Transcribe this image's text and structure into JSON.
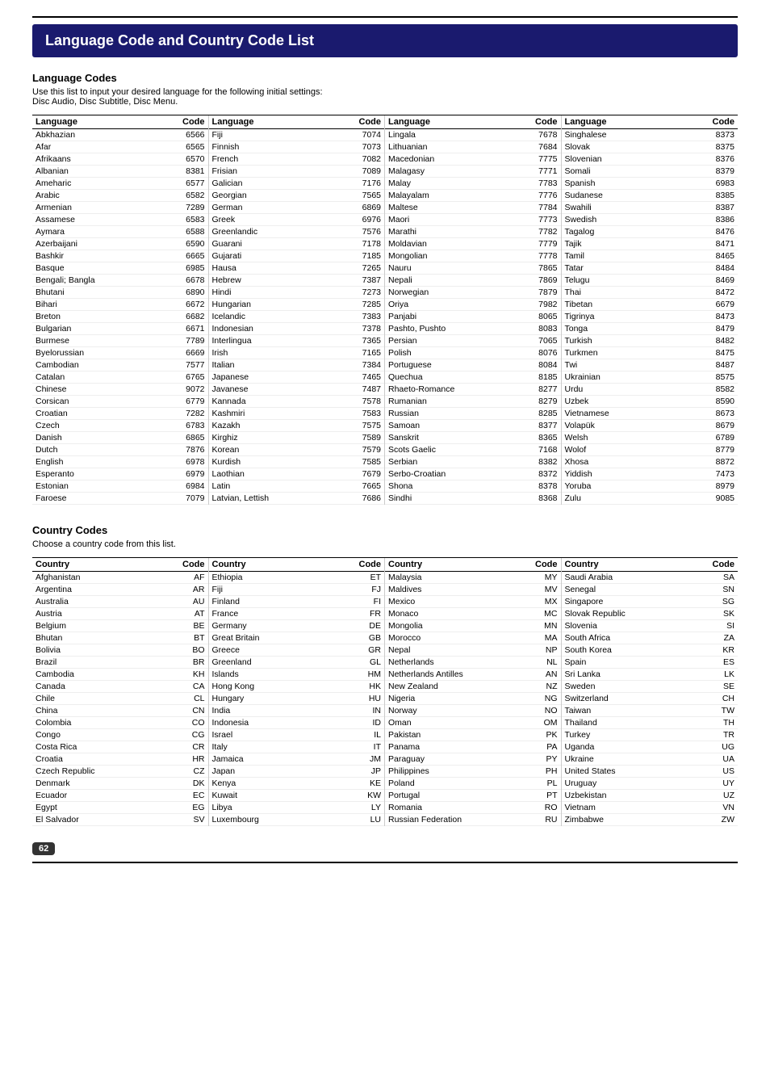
{
  "page": {
    "title": "Language Code and Country Code List",
    "language_section": {
      "heading": "Language Codes",
      "desc1": "Use this list to input your desired language for the following initial settings:",
      "desc2": "Disc Audio, Disc Subtitle, Disc Menu."
    },
    "country_section": {
      "heading": "Country Codes",
      "desc1": "Choose a country code from this list."
    },
    "page_number": "62"
  },
  "language_columns": [
    {
      "header_lang": "Language",
      "header_code": "Code",
      "rows": [
        [
          "Abkhazian",
          "6566"
        ],
        [
          "Afar",
          "6565"
        ],
        [
          "Afrikaans",
          "6570"
        ],
        [
          "Albanian",
          "8381"
        ],
        [
          "Ameharic",
          "6577"
        ],
        [
          "Arabic",
          "6582"
        ],
        [
          "Armenian",
          "7289"
        ],
        [
          "Assamese",
          "6583"
        ],
        [
          "Aymara",
          "6588"
        ],
        [
          "Azerbaijani",
          "6590"
        ],
        [
          "Bashkir",
          "6665"
        ],
        [
          "Basque",
          "6985"
        ],
        [
          "Bengali; Bangla",
          "6678"
        ],
        [
          "Bhutani",
          "6890"
        ],
        [
          "Bihari",
          "6672"
        ],
        [
          "Breton",
          "6682"
        ],
        [
          "Bulgarian",
          "6671"
        ],
        [
          "Burmese",
          "7789"
        ],
        [
          "Byelorussian",
          "6669"
        ],
        [
          "Cambodian",
          "7577"
        ],
        [
          "Catalan",
          "6765"
        ],
        [
          "Chinese",
          "9072"
        ],
        [
          "Corsican",
          "6779"
        ],
        [
          "Croatian",
          "7282"
        ],
        [
          "Czech",
          "6783"
        ],
        [
          "Danish",
          "6865"
        ],
        [
          "Dutch",
          "7876"
        ],
        [
          "English",
          "6978"
        ],
        [
          "Esperanto",
          "6979"
        ],
        [
          "Estonian",
          "6984"
        ],
        [
          "Faroese",
          "7079"
        ]
      ]
    },
    {
      "header_lang": "Language",
      "header_code": "Code",
      "rows": [
        [
          "Fiji",
          "7074"
        ],
        [
          "Finnish",
          "7073"
        ],
        [
          "French",
          "7082"
        ],
        [
          "Frisian",
          "7089"
        ],
        [
          "Galician",
          "7176"
        ],
        [
          "Georgian",
          "7565"
        ],
        [
          "German",
          "6869"
        ],
        [
          "Greek",
          "6976"
        ],
        [
          "Greenlandic",
          "7576"
        ],
        [
          "Guarani",
          "7178"
        ],
        [
          "Gujarati",
          "7185"
        ],
        [
          "Hausa",
          "7265"
        ],
        [
          "Hebrew",
          "7387"
        ],
        [
          "Hindi",
          "7273"
        ],
        [
          "Hungarian",
          "7285"
        ],
        [
          "Icelandic",
          "7383"
        ],
        [
          "Indonesian",
          "7378"
        ],
        [
          "Interlingua",
          "7365"
        ],
        [
          "Irish",
          "7165"
        ],
        [
          "Italian",
          "7384"
        ],
        [
          "Japanese",
          "7465"
        ],
        [
          "Javanese",
          "7487"
        ],
        [
          "Kannada",
          "7578"
        ],
        [
          "Kashmiri",
          "7583"
        ],
        [
          "Kazakh",
          "7575"
        ],
        [
          "Kirghiz",
          "7589"
        ],
        [
          "Korean",
          "7579"
        ],
        [
          "Kurdish",
          "7585"
        ],
        [
          "Laothian",
          "7679"
        ],
        [
          "Latin",
          "7665"
        ],
        [
          "Latvian, Lettish",
          "7686"
        ]
      ]
    },
    {
      "header_lang": "Language",
      "header_code": "Code",
      "rows": [
        [
          "Lingala",
          "7678"
        ],
        [
          "Lithuanian",
          "7684"
        ],
        [
          "Macedonian",
          "7775"
        ],
        [
          "Malagasy",
          "7771"
        ],
        [
          "Malay",
          "7783"
        ],
        [
          "Malayalam",
          "7776"
        ],
        [
          "Maltese",
          "7784"
        ],
        [
          "Maori",
          "7773"
        ],
        [
          "Marathi",
          "7782"
        ],
        [
          "Moldavian",
          "7779"
        ],
        [
          "Mongolian",
          "7778"
        ],
        [
          "Nauru",
          "7865"
        ],
        [
          "Nepali",
          "7869"
        ],
        [
          "Norwegian",
          "7879"
        ],
        [
          "Oriya",
          "7982"
        ],
        [
          "Panjabi",
          "8065"
        ],
        [
          "Pashto, Pushto",
          "8083"
        ],
        [
          "Persian",
          "7065"
        ],
        [
          "Polish",
          "8076"
        ],
        [
          "Portuguese",
          "8084"
        ],
        [
          "Quechua",
          "8185"
        ],
        [
          "Rhaeto-Romance",
          "8277"
        ],
        [
          "Rumanian",
          "8279"
        ],
        [
          "Russian",
          "8285"
        ],
        [
          "Samoan",
          "8377"
        ],
        [
          "Sanskrit",
          "8365"
        ],
        [
          "Scots Gaelic",
          "7168"
        ],
        [
          "Serbian",
          "8382"
        ],
        [
          "Serbo-Croatian",
          "8372"
        ],
        [
          "Shona",
          "8378"
        ],
        [
          "Sindhi",
          "8368"
        ]
      ]
    },
    {
      "header_lang": "Language",
      "header_code": "Code",
      "rows": [
        [
          "Singhalese",
          "8373"
        ],
        [
          "Slovak",
          "8375"
        ],
        [
          "Slovenian",
          "8376"
        ],
        [
          "Somali",
          "8379"
        ],
        [
          "Spanish",
          "6983"
        ],
        [
          "Sudanese",
          "8385"
        ],
        [
          "Swahili",
          "8387"
        ],
        [
          "Swedish",
          "8386"
        ],
        [
          "Tagalog",
          "8476"
        ],
        [
          "Tajik",
          "8471"
        ],
        [
          "Tamil",
          "8465"
        ],
        [
          "Tatar",
          "8484"
        ],
        [
          "Telugu",
          "8469"
        ],
        [
          "Thai",
          "8472"
        ],
        [
          "Tibetan",
          "6679"
        ],
        [
          "Tigrinya",
          "8473"
        ],
        [
          "Tonga",
          "8479"
        ],
        [
          "Turkish",
          "8482"
        ],
        [
          "Turkmen",
          "8475"
        ],
        [
          "Twi",
          "8487"
        ],
        [
          "Ukrainian",
          "8575"
        ],
        [
          "Urdu",
          "8582"
        ],
        [
          "Uzbek",
          "8590"
        ],
        [
          "Vietnamese",
          "8673"
        ],
        [
          "Volapük",
          "8679"
        ],
        [
          "Welsh",
          "6789"
        ],
        [
          "Wolof",
          "8779"
        ],
        [
          "Xhosa",
          "8872"
        ],
        [
          "Yiddish",
          "7473"
        ],
        [
          "Yoruba",
          "8979"
        ],
        [
          "Zulu",
          "9085"
        ]
      ]
    }
  ],
  "country_columns": [
    {
      "header_country": "Country",
      "header_code": "Code",
      "rows": [
        [
          "Afghanistan",
          "AF"
        ],
        [
          "Argentina",
          "AR"
        ],
        [
          "Australia",
          "AU"
        ],
        [
          "Austria",
          "AT"
        ],
        [
          "Belgium",
          "BE"
        ],
        [
          "Bhutan",
          "BT"
        ],
        [
          "Bolivia",
          "BO"
        ],
        [
          "Brazil",
          "BR"
        ],
        [
          "Cambodia",
          "KH"
        ],
        [
          "Canada",
          "CA"
        ],
        [
          "Chile",
          "CL"
        ],
        [
          "China",
          "CN"
        ],
        [
          "Colombia",
          "CO"
        ],
        [
          "Congo",
          "CG"
        ],
        [
          "Costa Rica",
          "CR"
        ],
        [
          "Croatia",
          "HR"
        ],
        [
          "Czech Republic",
          "CZ"
        ],
        [
          "Denmark",
          "DK"
        ],
        [
          "Ecuador",
          "EC"
        ],
        [
          "Egypt",
          "EG"
        ],
        [
          "El Salvador",
          "SV"
        ]
      ]
    },
    {
      "header_country": "Country",
      "header_code": "Code",
      "rows": [
        [
          "Ethiopia",
          "ET"
        ],
        [
          "Fiji",
          "FJ"
        ],
        [
          "Finland",
          "FI"
        ],
        [
          "France",
          "FR"
        ],
        [
          "Germany",
          "DE"
        ],
        [
          "Great Britain",
          "GB"
        ],
        [
          "Greece",
          "GR"
        ],
        [
          "Greenland",
          "GL"
        ],
        [
          "Islands",
          "HM"
        ],
        [
          "Hong Kong",
          "HK"
        ],
        [
          "Hungary",
          "HU"
        ],
        [
          "India",
          "IN"
        ],
        [
          "Indonesia",
          "ID"
        ],
        [
          "Israel",
          "IL"
        ],
        [
          "Italy",
          "IT"
        ],
        [
          "Jamaica",
          "JM"
        ],
        [
          "Japan",
          "JP"
        ],
        [
          "Kenya",
          "KE"
        ],
        [
          "Kuwait",
          "KW"
        ],
        [
          "Libya",
          "LY"
        ],
        [
          "Luxembourg",
          "LU"
        ]
      ]
    },
    {
      "header_country": "Country",
      "header_code": "Code",
      "rows": [
        [
          "Malaysia",
          "MY"
        ],
        [
          "Maldives",
          "MV"
        ],
        [
          "Mexico",
          "MX"
        ],
        [
          "Monaco",
          "MC"
        ],
        [
          "Mongolia",
          "MN"
        ],
        [
          "Morocco",
          "MA"
        ],
        [
          "Nepal",
          "NP"
        ],
        [
          "Netherlands",
          "NL"
        ],
        [
          "Netherlands Antilles",
          "AN"
        ],
        [
          "New Zealand",
          "NZ"
        ],
        [
          "Nigeria",
          "NG"
        ],
        [
          "Norway",
          "NO"
        ],
        [
          "Oman",
          "OM"
        ],
        [
          "Pakistan",
          "PK"
        ],
        [
          "Panama",
          "PA"
        ],
        [
          "Paraguay",
          "PY"
        ],
        [
          "Philippines",
          "PH"
        ],
        [
          "Poland",
          "PL"
        ],
        [
          "Portugal",
          "PT"
        ],
        [
          "Romania",
          "RO"
        ],
        [
          "Russian Federation",
          "RU"
        ]
      ]
    },
    {
      "header_country": "Country",
      "header_code": "Code",
      "rows": [
        [
          "Saudi Arabia",
          "SA"
        ],
        [
          "Senegal",
          "SN"
        ],
        [
          "Singapore",
          "SG"
        ],
        [
          "Slovak Republic",
          "SK"
        ],
        [
          "Slovenia",
          "SI"
        ],
        [
          "South Africa",
          "ZA"
        ],
        [
          "South Korea",
          "KR"
        ],
        [
          "Spain",
          "ES"
        ],
        [
          "Sri Lanka",
          "LK"
        ],
        [
          "Sweden",
          "SE"
        ],
        [
          "Switzerland",
          "CH"
        ],
        [
          "Taiwan",
          "TW"
        ],
        [
          "Thailand",
          "TH"
        ],
        [
          "Turkey",
          "TR"
        ],
        [
          "Uganda",
          "UG"
        ],
        [
          "Ukraine",
          "UA"
        ],
        [
          "United States",
          "US"
        ],
        [
          "Uruguay",
          "UY"
        ],
        [
          "Uzbekistan",
          "UZ"
        ],
        [
          "Vietnam",
          "VN"
        ],
        [
          "Zimbabwe",
          "ZW"
        ]
      ]
    }
  ]
}
